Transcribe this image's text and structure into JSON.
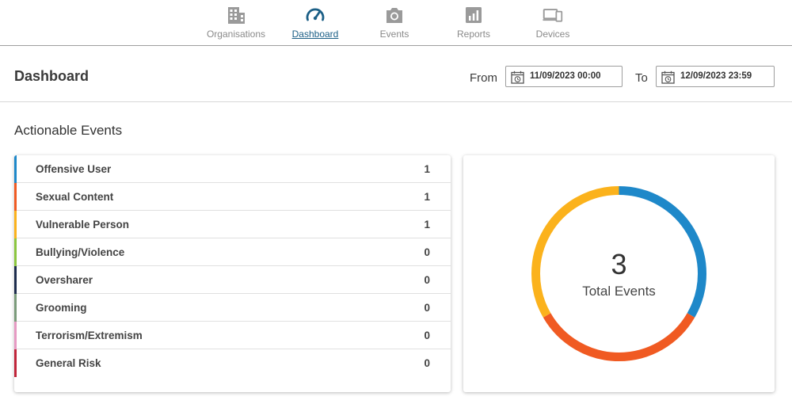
{
  "nav": {
    "items": [
      {
        "label": "Organisations",
        "icon": "building-icon",
        "active": false
      },
      {
        "label": "Dashboard",
        "icon": "gauge-icon",
        "active": true
      },
      {
        "label": "Events",
        "icon": "camera-icon",
        "active": false
      },
      {
        "label": "Reports",
        "icon": "bar-chart-icon",
        "active": false
      },
      {
        "label": "Devices",
        "icon": "devices-icon",
        "active": false
      }
    ]
  },
  "header": {
    "title": "Dashboard",
    "from_label": "From",
    "from_value": "11/09/2023 00:00",
    "to_label": "To",
    "to_value": "12/09/2023 23:59"
  },
  "section_title": "Actionable Events",
  "events": [
    {
      "name": "Offensive User",
      "count": "1",
      "color": "#1e88c9"
    },
    {
      "name": "Sexual Content",
      "count": "1",
      "color": "#f05a22"
    },
    {
      "name": "Vulnerable Person",
      "count": "1",
      "color": "#fbb21c"
    },
    {
      "name": "Bullying/Violence",
      "count": "0",
      "color": "#8cc63f"
    },
    {
      "name": "Oversharer",
      "count": "0",
      "color": "#1d2c4d"
    },
    {
      "name": "Grooming",
      "count": "0",
      "color": "#7b9b7b"
    },
    {
      "name": "Terrorism/Extremism",
      "count": "0",
      "color": "#e69ac3"
    },
    {
      "name": "General Risk",
      "count": "0",
      "color": "#c0253a"
    }
  ],
  "total": {
    "value": "3",
    "label": "Total Events"
  },
  "colors": {
    "nav_active": "#1b5f86",
    "nav_inactive": "#8a8a8a"
  }
}
